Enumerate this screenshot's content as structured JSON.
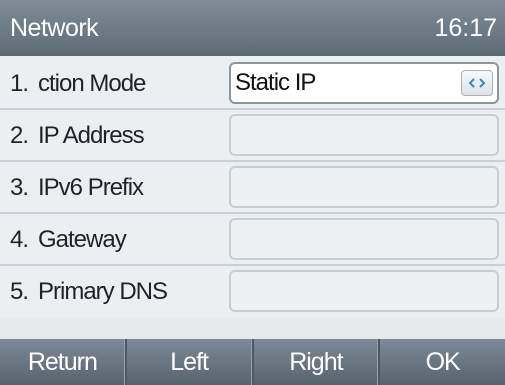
{
  "header": {
    "title": "Network",
    "time": "16:17"
  },
  "rows": [
    {
      "num": "1.",
      "label": "ction Mode",
      "value": "Static IP",
      "has_toggle": true,
      "toggle_icon": "left-right-arrows-icon"
    },
    {
      "num": "2.",
      "label": "IP Address",
      "value": ""
    },
    {
      "num": "3.",
      "label": "IPv6 Prefix",
      "value": ""
    },
    {
      "num": "4.",
      "label": "Gateway",
      "value": ""
    },
    {
      "num": "5.",
      "label": "Primary DNS",
      "value": ""
    }
  ],
  "softkeys": [
    "Return",
    "Left",
    "Right",
    "OK"
  ],
  "colors": {
    "header_bg": "#6d7b86",
    "softkey_bg": "#66737e",
    "toggle_arrow": "#3a86c8"
  }
}
